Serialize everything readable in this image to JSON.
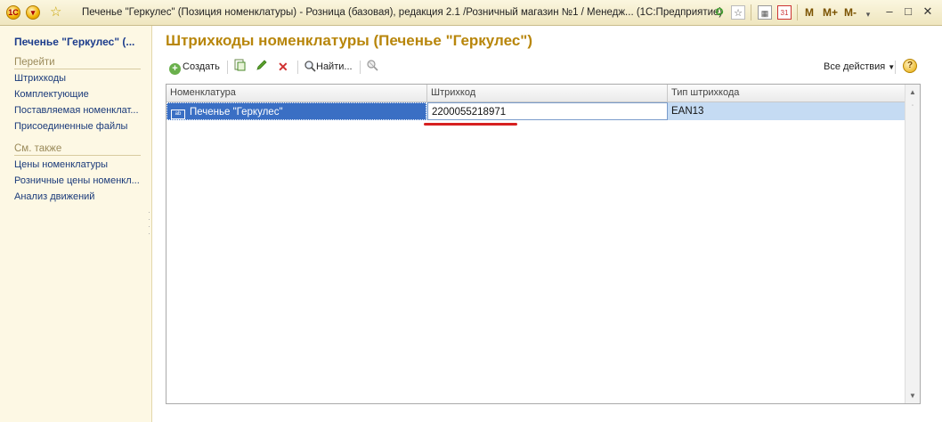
{
  "window": {
    "title": "Печенье \"Геркулес\" (Позиция номенклатуры) - Розница (базовая), редакция 2.1 /Розничный магазин №1 / Менедж... (1С:Предприятие)",
    "m_buttons": [
      "M",
      "M+",
      "M-"
    ]
  },
  "left_panel": {
    "title": "Печенье \"Геркулес\" (...",
    "goto_section": "Перейти",
    "goto_items": [
      "Штрихкоды",
      "Комплектующие",
      "Поставляемая номенклат...",
      "Присоединенные файлы"
    ],
    "see_also_section": "См. также",
    "see_also_items": [
      "Цены номенклатуры",
      "Розничные цены номенкл...",
      "Анализ движений"
    ]
  },
  "main": {
    "title": "Штрихкоды номенклатуры (Печенье \"Геркулес\")",
    "toolbar": {
      "create_label": "Создать",
      "find_label": "Найти...",
      "all_actions_label": "Все действия",
      "help_label": "?"
    },
    "table": {
      "columns": [
        "Номенклатура",
        "Штрихкод",
        "Тип штрихкода"
      ],
      "rows": [
        {
          "nomenclature": "Печенье \"Геркулес\"",
          "barcode": "2200055218971",
          "barcode_type": "EAN13"
        }
      ]
    }
  },
  "colors": {
    "title_accent": "#b8860b",
    "link": "#1a3a7a",
    "selection_row": "#c5dbf3",
    "highlight_underline": "#d62020"
  }
}
